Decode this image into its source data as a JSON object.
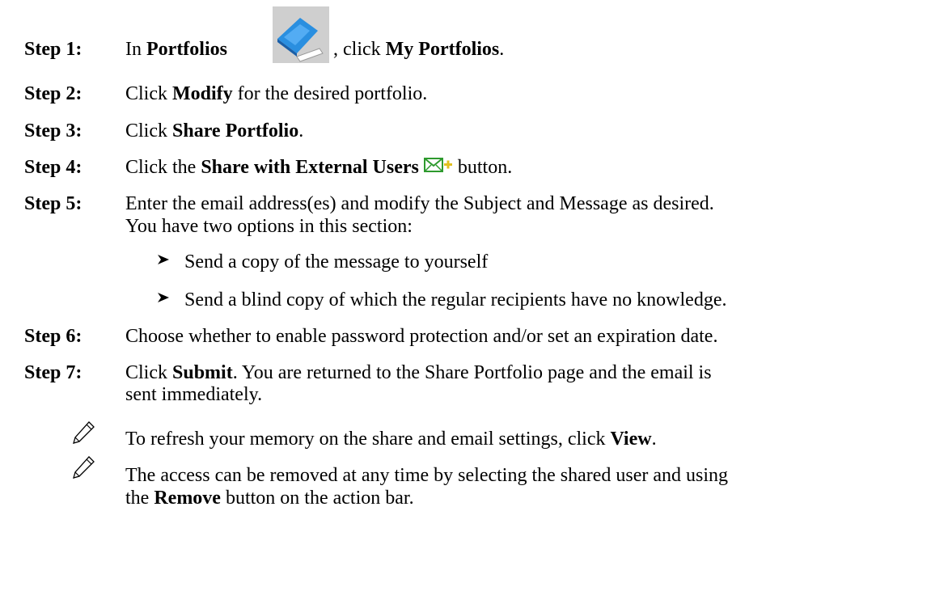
{
  "steps": [
    {
      "label": "Step 1:",
      "pre": "In ",
      "b1": "Portfolios",
      "mid": " , click ",
      "b2": "My Portfolios",
      "post": ".",
      "icon": "portfolio-icon"
    },
    {
      "label": "Step 2:",
      "pre": "Click ",
      "b1": "Modify",
      "post": " for the desired portfolio."
    },
    {
      "label": "Step 3:",
      "pre": "Click ",
      "b1": "Share Portfolio",
      "post": "."
    },
    {
      "label": "Step 4:",
      "pre": "Click the ",
      "b1": "Share with External Users",
      "post": " button.",
      "icon": "email-add-icon"
    },
    {
      "label": "Step 5:",
      "line1": "Enter the email address(es) and modify the Subject and Message as desired.",
      "line2": "You have two options in this section:",
      "bullets": [
        "Send a copy of the message to yourself",
        "Send a blind copy of which the regular recipients have no knowledge."
      ]
    },
    {
      "label": "Step 6:",
      "text": "Choose whether to enable password protection and/or set an expiration date."
    },
    {
      "label": "Step 7:",
      "pre": "Click ",
      "b1": "Submit",
      "post": ". You are returned to the Share Portfolio page and the email is",
      "line2": "sent immediately."
    }
  ],
  "notes": [
    {
      "pre": "To refresh your memory on the share and email settings, click ",
      "b1": "View",
      "post": "."
    },
    {
      "pre": "The access can be removed at any time by selecting the shared user and using",
      "line2_pre": "the ",
      "b1": "Remove",
      "line2_post": " button on the action bar."
    }
  ],
  "icons": {
    "note": "pencil-icon",
    "bullet": "arrow-bullet-icon"
  },
  "colors": {
    "portfolio_blue": "#2a8fe0",
    "icon_bg": "#cfcfcf",
    "email_green": "#2e9a2e"
  }
}
